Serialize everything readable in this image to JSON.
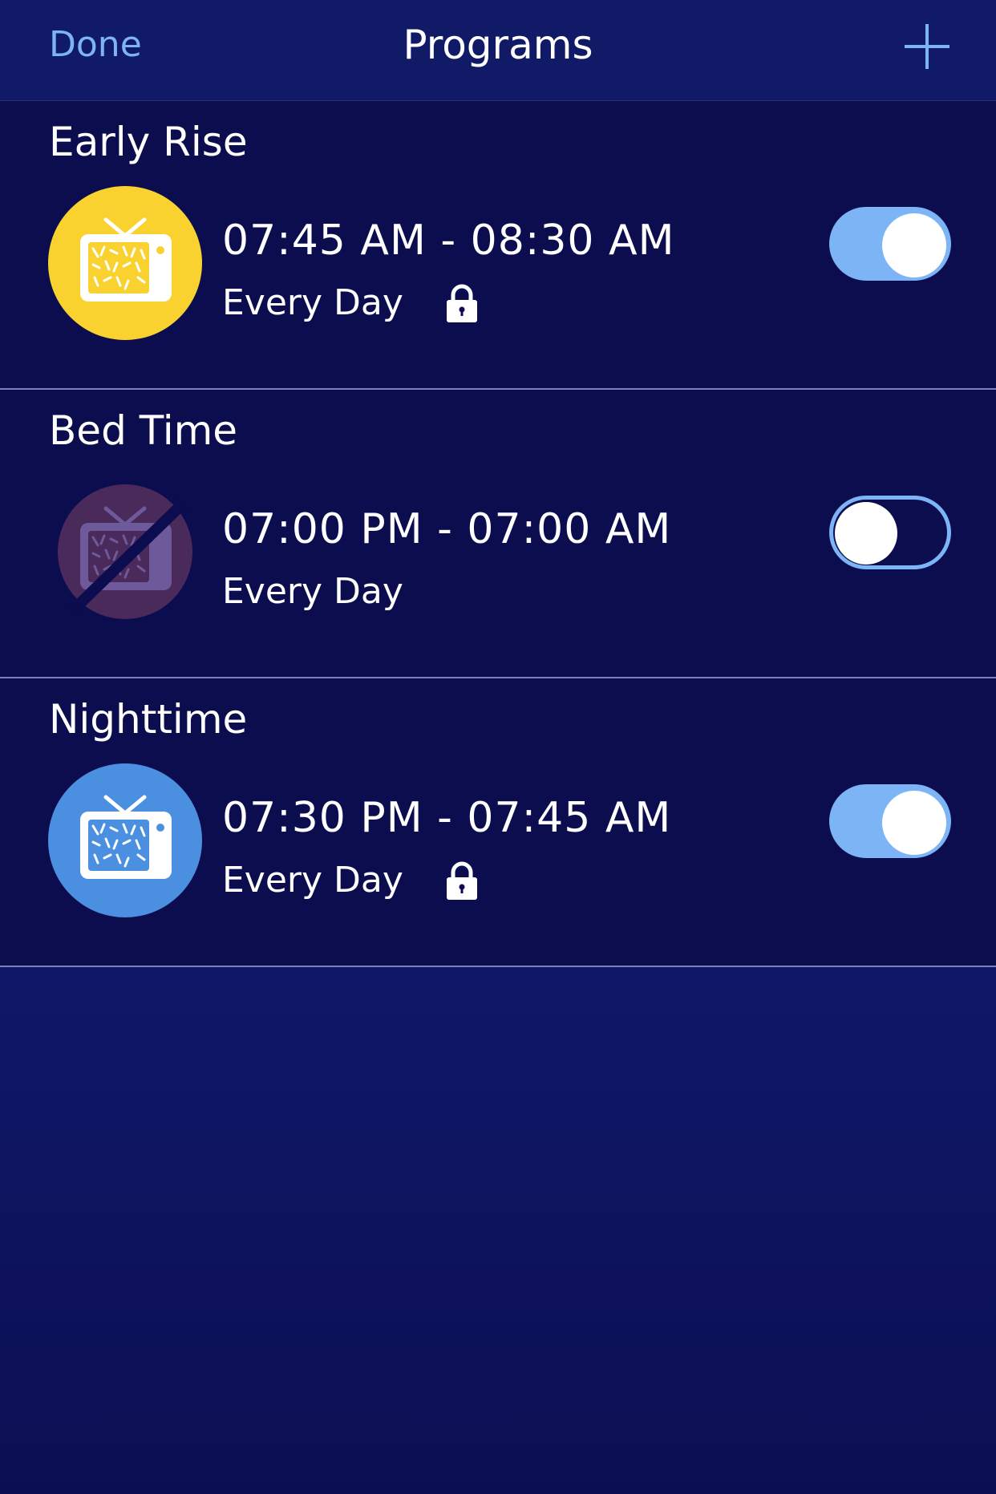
{
  "navbar": {
    "done_label": "Done",
    "title": "Programs",
    "add_icon": "plus-icon"
  },
  "programs": [
    {
      "name": "Early Rise",
      "time_range": "07:45 AM - 08:30 AM",
      "recurrence": "Every Day",
      "locked": true,
      "enabled": true,
      "icon": "tv-icon",
      "icon_color": "#f9d230",
      "icon_state": "active"
    },
    {
      "name": "Bed Time",
      "time_range": "07:00 PM - 07:00 AM",
      "recurrence": "Every Day",
      "locked": false,
      "enabled": false,
      "icon": "tv-off-icon",
      "icon_color": "#4a2a5a",
      "icon_state": "disabled"
    },
    {
      "name": "Nighttime",
      "time_range": "07:30 PM - 07:45 AM",
      "recurrence": "Every Day",
      "locked": true,
      "enabled": true,
      "icon": "tv-icon",
      "icon_color": "#4a8fe0",
      "icon_state": "active"
    }
  ],
  "colors": {
    "accent": "#7cb4f6",
    "background": "#0c0d4f",
    "navbar": "#111a66",
    "divider": "#7a82b8"
  }
}
